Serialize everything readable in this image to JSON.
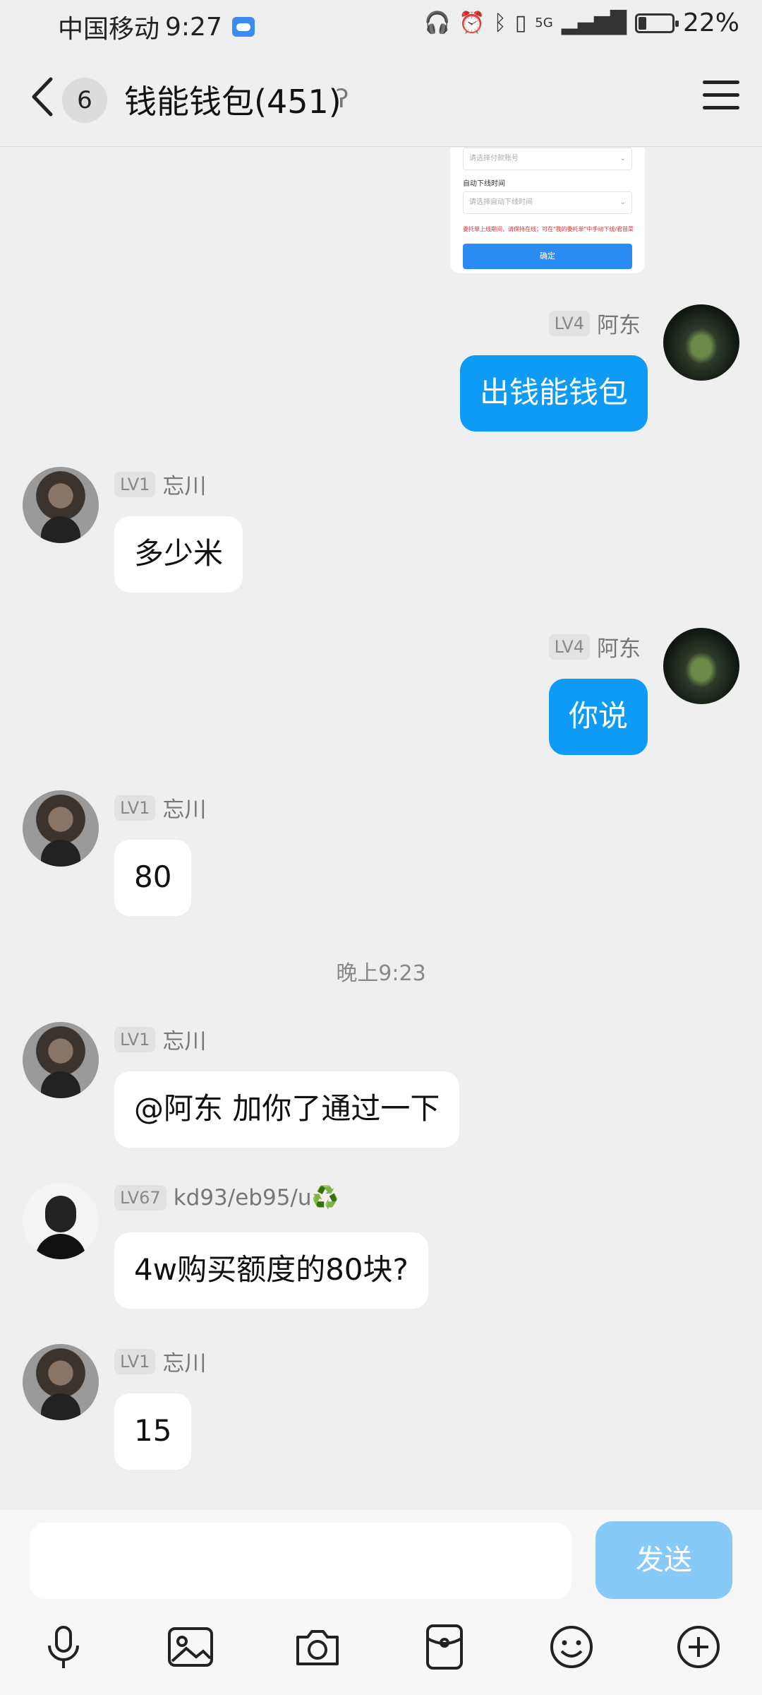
{
  "status": {
    "carrier": "中国移动",
    "time": "9:27",
    "battery": "22%",
    "signal_label": "5G"
  },
  "header": {
    "unread": "6",
    "title": "钱能钱包(451)"
  },
  "image_card": {
    "select1_placeholder": "请选择付款账号",
    "label2": "自动下线时间",
    "select2_placeholder": "请选择自动下线时间",
    "warning": "委托单上线期间，请保持在线；可在\"我的委托单\"中手动下线/君苗菜",
    "confirm_label": "确定"
  },
  "messages": [
    {
      "sender": "阿东",
      "level": "LV4",
      "text": "出钱能钱包",
      "direction": "out"
    },
    {
      "sender": "忘川",
      "level": "LV1",
      "text": "多少米",
      "direction": "in"
    },
    {
      "sender": "阿东",
      "level": "LV4",
      "text": "你说",
      "direction": "out"
    },
    {
      "sender": "忘川",
      "level": "LV1",
      "text": "80",
      "direction": "in"
    },
    {
      "sender": "忘川",
      "level": "LV1",
      "text": "@阿东 加你了通过一下",
      "direction": "in"
    },
    {
      "sender": "kd93/eb95/u♻️",
      "level": "LV67",
      "text": "4w购买额度的80块?",
      "direction": "in"
    },
    {
      "sender": "忘川",
      "level": "LV1",
      "text": "15",
      "direction": "in"
    }
  ],
  "timestamp": "晚上9:23",
  "input": {
    "placeholder": "",
    "send_label": "发送"
  },
  "toolbar": [
    "microphone-icon",
    "image-icon",
    "camera-icon",
    "red-packet-icon",
    "emoji-icon",
    "plus-icon"
  ]
}
